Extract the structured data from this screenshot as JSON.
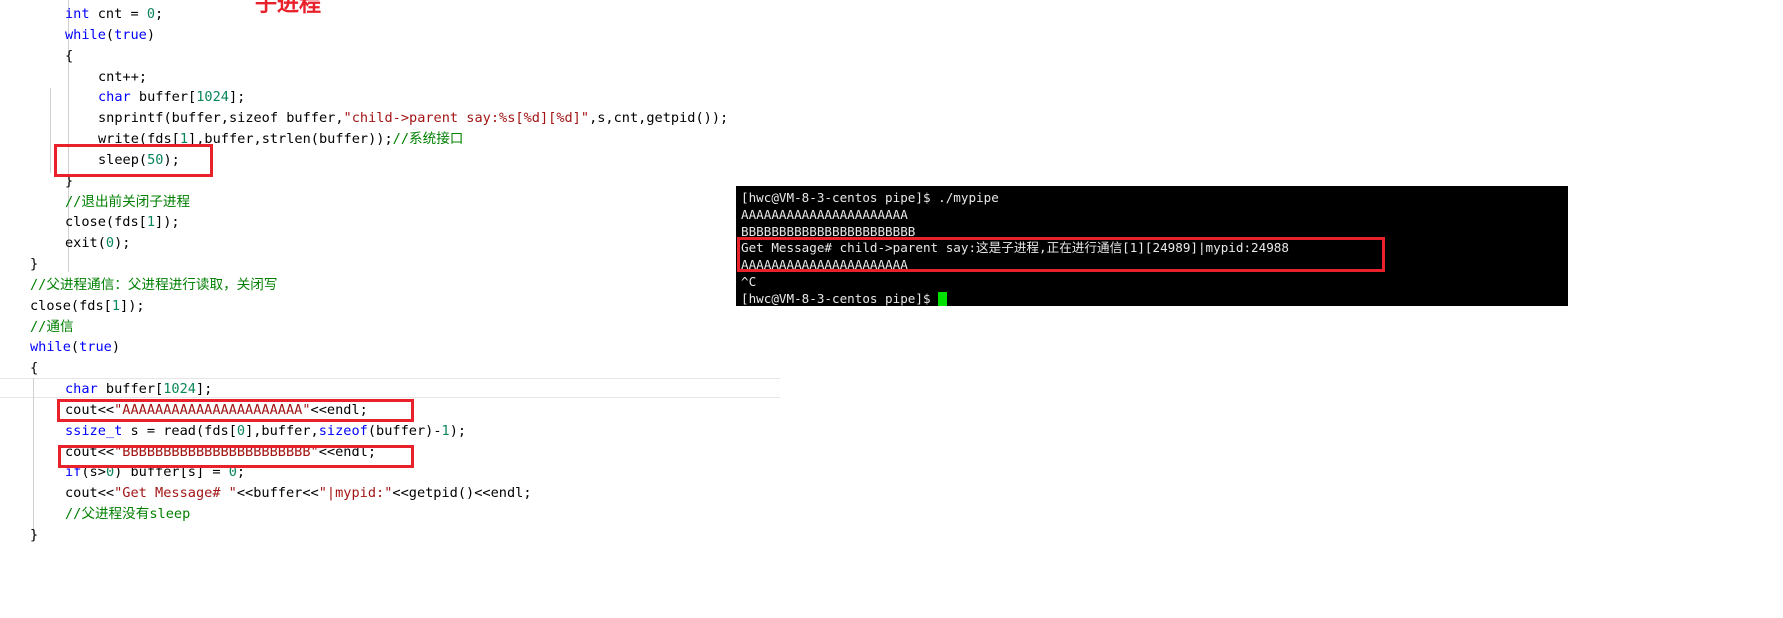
{
  "annotation_title": "子进程",
  "code_lines": [
    {
      "indent": 1,
      "tokens": [
        [
          "int",
          "kw"
        ],
        " cnt = ",
        [
          "0",
          "num"
        ],
        ";"
      ]
    },
    {
      "indent": 1,
      "tokens": [
        [
          "while",
          "kw"
        ],
        "(",
        [
          "true",
          "kw"
        ],
        ")"
      ]
    },
    {
      "indent": 1,
      "tokens": [
        "{"
      ]
    },
    {
      "indent": 2,
      "tokens": [
        "cnt++;"
      ]
    },
    {
      "indent": 2,
      "tokens": [
        [
          "char",
          "kw"
        ],
        " buffer[",
        [
          "1024",
          "num"
        ],
        "];"
      ]
    },
    {
      "indent": 2,
      "tokens": [
        "snprintf(buffer,sizeof buffer,",
        [
          "\"child->parent say:%s[%d][%d]\"",
          "str"
        ],
        ",s,cnt,getpid());"
      ]
    },
    {
      "indent": 2,
      "tokens": [
        "write(fds[",
        [
          "1",
          "num"
        ],
        "],buffer,strlen(buffer));",
        [
          "//系统接口",
          "cm"
        ]
      ]
    },
    {
      "indent": 2,
      "tokens": [
        "sleep(",
        [
          "50",
          "num"
        ],
        ");"
      ]
    },
    {
      "indent": 1,
      "tokens": [
        "}"
      ]
    },
    {
      "indent": 1,
      "tokens": [
        [
          "//退出前关闭子进程",
          "cm"
        ]
      ]
    },
    {
      "indent": 1,
      "tokens": [
        "close(fds[",
        [
          "1",
          "num"
        ],
        "]);"
      ]
    },
    {
      "indent": 1,
      "tokens": [
        "exit(",
        [
          "0",
          "num"
        ],
        ");"
      ]
    },
    {
      "indent": 0,
      "tokens": [
        "}"
      ]
    },
    {
      "indent": 0,
      "tokens": [
        [
          "//父进程通信：父进程进行读取，关闭写",
          "cm"
        ]
      ]
    },
    {
      "indent": 0,
      "tokens": [
        "close(fds[",
        [
          "1",
          "num"
        ],
        "]);"
      ]
    },
    {
      "indent": 0,
      "tokens": [
        [
          "//通信",
          "cm"
        ]
      ]
    },
    {
      "indent": 0,
      "tokens": [
        [
          "while",
          "kw"
        ],
        "(",
        [
          "true",
          "kw"
        ],
        ")"
      ]
    },
    {
      "indent": 0,
      "tokens": [
        "{"
      ]
    },
    {
      "indent": 1,
      "tokens": [
        [
          "char",
          "kw"
        ],
        " buffer[",
        [
          "1024",
          "num"
        ],
        "];"
      ]
    },
    {
      "indent": 1,
      "tokens": [
        "cout<<",
        [
          "\"AAAAAAAAAAAAAAAAAAAAAA\"",
          "str"
        ],
        "<<endl;"
      ]
    },
    {
      "indent": 1,
      "tokens": [
        [
          "ssize_t",
          "kw"
        ],
        " s = read(fds[",
        [
          "0",
          "num"
        ],
        "],buffer,",
        [
          "sizeof",
          "kw"
        ],
        "(buffer)-",
        [
          "1",
          "num"
        ],
        ");"
      ]
    },
    {
      "indent": 1,
      "tokens": [
        "cout<<",
        [
          "\"BBBBBBBBBBBBBBBBBBBBBBB\"",
          "str"
        ],
        "<<endl;"
      ]
    },
    {
      "indent": 1,
      "tokens": [
        [
          "if",
          "kw"
        ],
        "(s>",
        [
          "0",
          "num"
        ],
        ") buffer[s] = ",
        [
          "0",
          "num"
        ],
        ";"
      ]
    },
    {
      "indent": 1,
      "tokens": [
        "cout<<",
        [
          "\"Get Message# \"",
          "str"
        ],
        "<<buffer<<",
        [
          "\"|mypid:\"",
          "str"
        ],
        "<<getpid()<<endl;"
      ]
    },
    {
      "indent": 1,
      "tokens": [
        [
          "//父进程没有sleep",
          "cm"
        ]
      ]
    },
    {
      "indent": 0,
      "tokens": [
        "}"
      ]
    }
  ],
  "terminal": {
    "lines": [
      "[hwc@VM-8-3-centos pipe]$ ./mypipe",
      "AAAAAAAAAAAAAAAAAAAAAA",
      "BBBBBBBBBBBBBBBBBBBBBBB",
      "Get Message# child->parent say:这是子进程,正在进行通信[1][24989]|mypid:24988",
      "AAAAAAAAAAAAAAAAAAAAAA",
      "^C"
    ],
    "prompt": "[hwc@VM-8-3-centos pipe]$ "
  },
  "colors": {
    "highlight_box": "#e8212b",
    "keyword": "#0000ff",
    "string": "#a31515",
    "number": "#098658",
    "comment": "#008000",
    "cursor": "#00e000"
  }
}
